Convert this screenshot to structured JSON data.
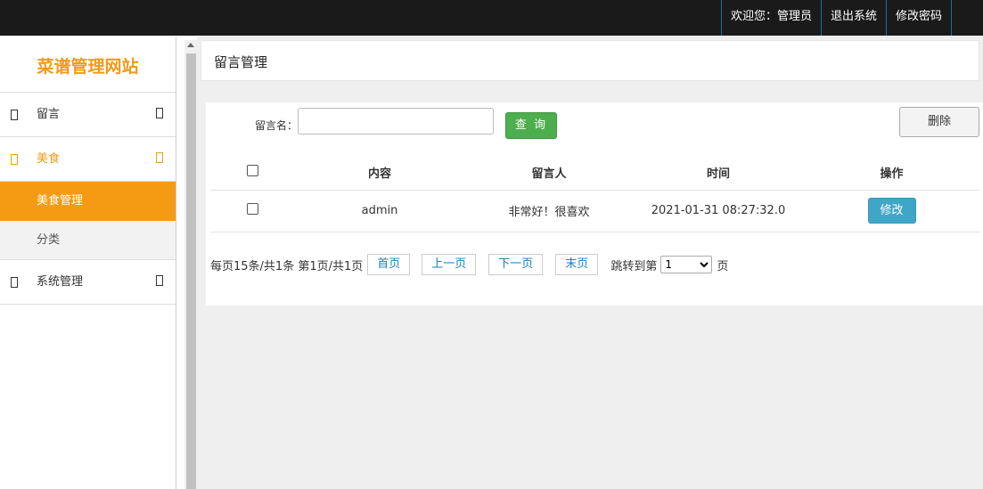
{
  "topbar": {
    "welcome": "欢迎您：管理员",
    "logout": "退出系统",
    "change_password": "修改密码"
  },
  "sidebar": {
    "logo": "菜谱管理网站",
    "items": [
      {
        "label": "留言",
        "active": false
      },
      {
        "label": "美食",
        "active": true,
        "children": [
          {
            "label": "美食管理",
            "selected": true
          },
          {
            "label": "分类",
            "selected": false
          }
        ]
      },
      {
        "label": "系统管理",
        "active": false
      }
    ]
  },
  "main": {
    "page_title": "留言管理",
    "search": {
      "label": "留言名：",
      "value": "",
      "query_button": "查 询"
    },
    "delete_button": "删除",
    "table": {
      "headers": [
        "内容",
        "留言人",
        "时间",
        "操作"
      ],
      "rows": [
        {
          "content": "admin",
          "author": "非常好！很喜欢",
          "time": "2021-01-31 08:27:32.0",
          "action": "修改"
        }
      ]
    },
    "pager": {
      "summary": "每页15条/共1条 第1页/共1页",
      "first": "首页",
      "prev": "上一页",
      "next": "下一页",
      "last": "末页",
      "jump_label": "跳转到第",
      "jump_value": "1",
      "page_suffix": "页"
    }
  },
  "colors": {
    "topbar_bg": "#1a1a1a",
    "accent": "#f49b13",
    "query_button": "#4cae4c",
    "edit_button": "#3fa6c7"
  }
}
